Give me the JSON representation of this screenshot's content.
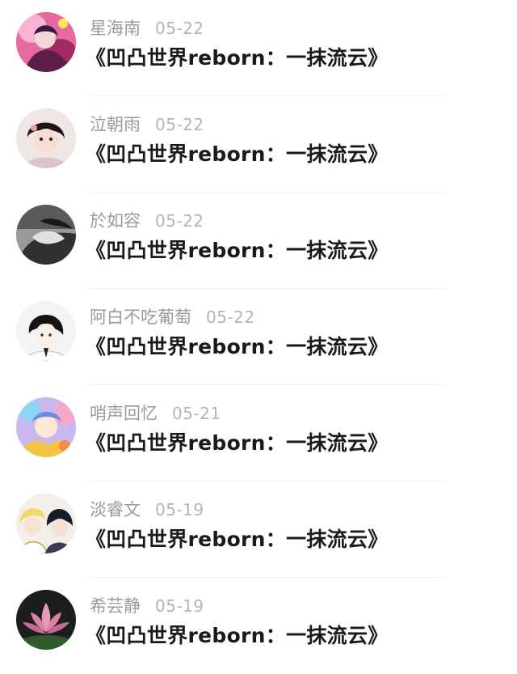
{
  "comments": [
    {
      "username": "星海南",
      "date": "05-22",
      "text": "《凹凸世界reborn：一抹流云》",
      "avatar_icon": "anime-girl-pink-avatar-icon",
      "avatar_color": "#c23d78"
    },
    {
      "username": "泣朝雨",
      "date": "05-22",
      "text": "《凹凸世界reborn：一抹流云》",
      "avatar_icon": "child-photo-avatar-icon",
      "avatar_color": "#e9dedc"
    },
    {
      "username": "於如容",
      "date": "05-22",
      "text": "《凹凸世界reborn：一抹流云》",
      "avatar_icon": "grayscale-portrait-avatar-icon",
      "avatar_color": "#8a8a8a"
    },
    {
      "username": "阿白不吃葡萄",
      "date": "05-22",
      "text": "《凹凸世界reborn：一抹流云》",
      "avatar_icon": "anime-boy-dark-hair-avatar-icon",
      "avatar_color": "#f2f2f2"
    },
    {
      "username": "哨声回忆",
      "date": "05-21",
      "text": "《凹凸世界reborn：一抹流云》",
      "avatar_icon": "colorful-anime-avatar-icon",
      "avatar_color": "#b9a4e0"
    },
    {
      "username": "淡睿文",
      "date": "05-19",
      "text": "《凹凸世界reborn：一抹流云》",
      "avatar_icon": "anime-duo-avatar-icon",
      "avatar_color": "#f0ece6"
    },
    {
      "username": "希芸静",
      "date": "05-19",
      "text": "《凹凸世界reborn：一抹流云》",
      "avatar_icon": "lotus-flower-avatar-icon",
      "avatar_color": "#2a2a2a"
    }
  ]
}
